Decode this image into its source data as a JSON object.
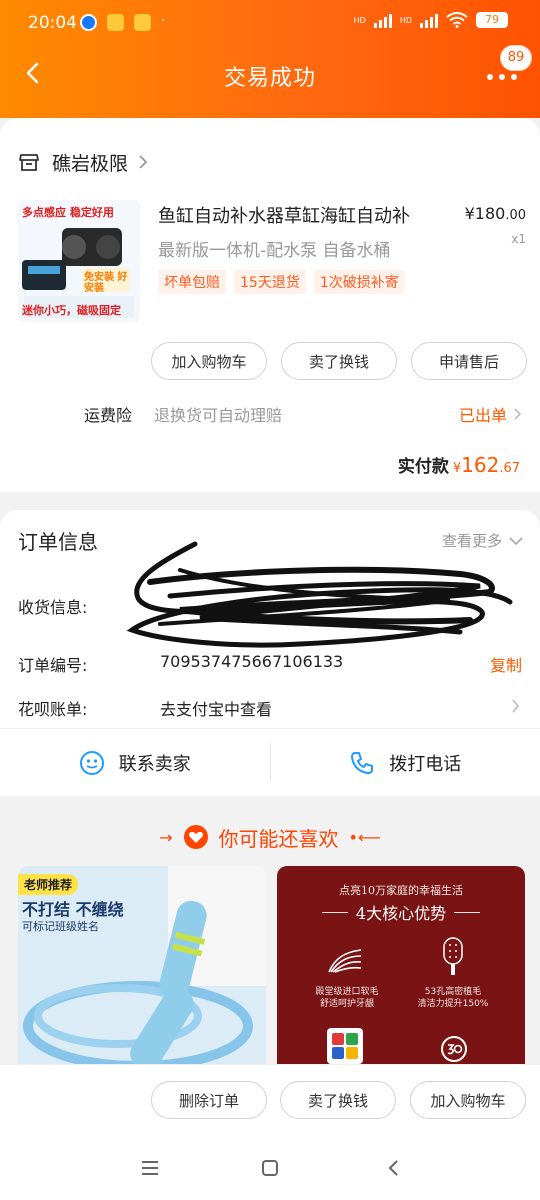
{
  "status_bar": {
    "time": "20:04",
    "battery": "79",
    "net1": "HD",
    "net2": "HD"
  },
  "nav": {
    "title": "交易成功",
    "badge_count": "89"
  },
  "shop": {
    "name": "礁岩极限"
  },
  "product": {
    "title": "鱼缸自动补水器草缸海缸自动补",
    "spec": "最新版一体机-配水泵 自备水桶",
    "price_symbol": "¥",
    "price_int": "180",
    "price_dec": ".00",
    "quantity": "x1",
    "tags": [
      "坏单包赔",
      "15天退货",
      "1次破损补寄"
    ],
    "thumb_text_top": "多点感应 稳定好用",
    "thumb_text_mid": "免安装 好安装",
    "thumb_text_bottom": "迷你小巧，磁吸固定"
  },
  "actions": {
    "add_cart": "加入购物车",
    "resell": "卖了换钱",
    "after_sale": "申请售后"
  },
  "insurance": {
    "label": "运费险",
    "desc": "退换货可自动理赔",
    "status": "已出单"
  },
  "payment": {
    "label": "实付款",
    "currency": "¥",
    "amount_int": "162",
    "amount_dec": ".67"
  },
  "order_info": {
    "title": "订单信息",
    "more": "查看更多",
    "shipping_label": "收货信息:",
    "order_no_label": "订单编号:",
    "order_no": "709537475667106133",
    "copy": "复制",
    "huabei_label": "花呗账单:",
    "huabei_value": "去支付宝中查看"
  },
  "contact": {
    "seller": "联系卖家",
    "phone": "拨打电话"
  },
  "recommend": {
    "title": "你可能还喜欢",
    "card1": {
      "badge": "老师推荐",
      "headline": "不打结 不缠绕",
      "sub": "可标记班级姓名"
    },
    "card2": {
      "slogan": "点亮10万家庭的幸福生活",
      "title": "4大核心优势",
      "f1a": "殿堂级进口软毛",
      "f1b": "舒适呵护牙龈",
      "f2a": "53孔高密植毛",
      "f2b": "清洁力提升150%"
    }
  },
  "bottom": {
    "delete": "删除订单",
    "resell": "卖了换钱",
    "add_cart": "加入购物车"
  },
  "colors": {
    "accent": "#ff5a00",
    "header_start": "#ff8a00",
    "header_end": "#ff5300"
  }
}
